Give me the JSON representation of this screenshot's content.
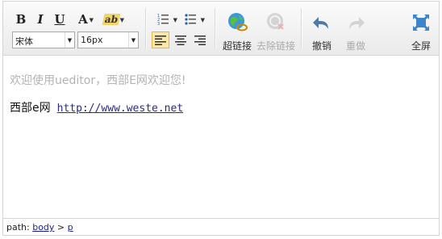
{
  "toolbar": {
    "font_family": "宋体",
    "font_size": "16px",
    "link_label": "超链接",
    "unlink_label": "去除链接",
    "undo_label": "撤销",
    "redo_label": "重做",
    "fullscreen_label": "全屏",
    "bold": "B",
    "italic": "I",
    "underline": "U",
    "font_color": "A",
    "highlight": "ab"
  },
  "content": {
    "placeholder": "欢迎使用ueditor，西部E网欢迎您!",
    "line_text": "西部e网",
    "link_text": "http://www.weste.net"
  },
  "statusbar": {
    "prefix": "path: ",
    "crumb_body": "body",
    "sep": " > ",
    "crumb_p": "p"
  },
  "colors": {
    "accent": "#f3d46a",
    "link": "#2a2a8c",
    "placeholder": "#b3b3b3"
  }
}
